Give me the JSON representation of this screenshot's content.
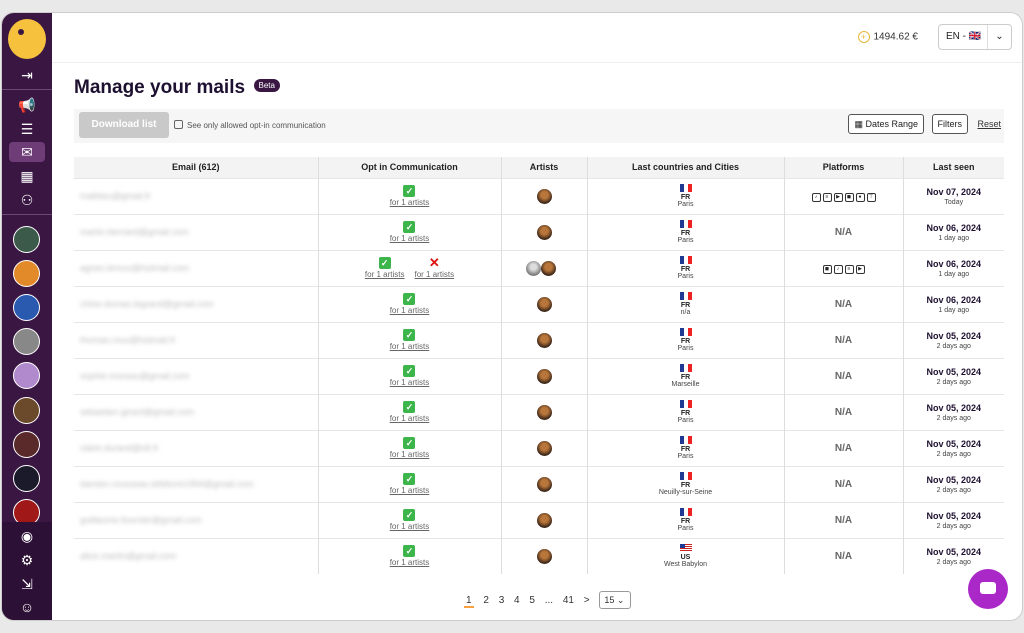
{
  "header": {
    "balance": "1494.62 €",
    "language": "EN - 🇬🇧",
    "coin_symbol": "+"
  },
  "page": {
    "title": "Manage your mails",
    "badge": "Beta"
  },
  "toolbar": {
    "download_label": "Download list",
    "optin_filter_label": "See only allowed opt-in communication",
    "dates_range_label": "Dates Range",
    "filters_label": "Filters",
    "reset_label": "Reset"
  },
  "table": {
    "columns": [
      "Email (612)",
      "Opt in Communication",
      "Artists",
      "Last countries and Cities",
      "Platforms",
      "Last seen"
    ],
    "rows": [
      {
        "email": "mathieu@gmail.fr",
        "opt": [
          "for 1 artists"
        ],
        "optout": "",
        "artists": 1,
        "country": "FR",
        "city": "Paris",
        "platforms": [
          "♪",
          "≡",
          "▶",
          "◼",
          "●",
          "⊤"
        ],
        "platforms_na": "",
        "date": "Nov 07, 2024",
        "ago": "Today"
      },
      {
        "email": "martin.bernard@gmail.com",
        "opt": [
          "for 1 artists"
        ],
        "optout": "",
        "artists": 1,
        "country": "FR",
        "city": "Paris",
        "platforms": [],
        "platforms_na": "N/A",
        "date": "Nov 06, 2024",
        "ago": "1 day ago"
      },
      {
        "email": "agnes.leroux@hotmail.com",
        "opt": [
          "for 1 artists"
        ],
        "optout": "for 1 artists",
        "artists": 2,
        "country": "FR",
        "city": "Paris",
        "platforms": [
          "◼",
          "♪",
          "≡",
          "▶"
        ],
        "platforms_na": "",
        "date": "Nov 06, 2024",
        "ago": "1 day ago"
      },
      {
        "email": "chloe.dumas.legrand@gmail.com",
        "opt": [
          "for 1 artists"
        ],
        "optout": "",
        "artists": 1,
        "country": "FR",
        "city": "n/a",
        "platforms": [],
        "platforms_na": "N/A",
        "date": "Nov 06, 2024",
        "ago": "1 day ago"
      },
      {
        "email": "thomas.roux@hotmail.fr",
        "opt": [
          "for 1 artists"
        ],
        "optout": "",
        "artists": 1,
        "country": "FR",
        "city": "Paris",
        "platforms": [],
        "platforms_na": "N/A",
        "date": "Nov 05, 2024",
        "ago": "2 days ago"
      },
      {
        "email": "sophie.moreau@gmail.com",
        "opt": [
          "for 1 artists"
        ],
        "optout": "",
        "artists": 1,
        "country": "FR",
        "city": "Marseille",
        "platforms": [],
        "platforms_na": "N/A",
        "date": "Nov 05, 2024",
        "ago": "2 days ago"
      },
      {
        "email": "sebastien.girard@gmail.com",
        "opt": [
          "for 1 artists"
        ],
        "optout": "",
        "artists": 1,
        "country": "FR",
        "city": "Paris",
        "platforms": [],
        "platforms_na": "N/A",
        "date": "Nov 05, 2024",
        "ago": "2 days ago"
      },
      {
        "email": "claire.durand@sfr.fr",
        "opt": [
          "for 1 artists"
        ],
        "optout": "",
        "artists": 1,
        "country": "FR",
        "city": "Paris",
        "platforms": [],
        "platforms_na": "N/A",
        "date": "Nov 05, 2024",
        "ago": "2 days ago"
      },
      {
        "email": "damien.rousseau.lefebvre1994@gmail.com",
        "opt": [
          "for 1 artists"
        ],
        "optout": "",
        "artists": 1,
        "country": "FR",
        "city": "Neuilly-sur-Seine",
        "platforms": [],
        "platforms_na": "N/A",
        "date": "Nov 05, 2024",
        "ago": "2 days ago"
      },
      {
        "email": "guillaume.fournier@gmail.com",
        "opt": [
          "for 1 artists"
        ],
        "optout": "",
        "artists": 1,
        "country": "FR",
        "city": "Paris",
        "platforms": [],
        "platforms_na": "N/A",
        "date": "Nov 05, 2024",
        "ago": "2 days ago"
      },
      {
        "email": "alice.martin@gmail.com",
        "opt": [
          "for 1 artists"
        ],
        "optout": "",
        "artists": 1,
        "country": "US",
        "city": "West Babylon",
        "platforms": [],
        "platforms_na": "N/A",
        "date": "Nov 05, 2024",
        "ago": "2 days ago"
      }
    ]
  },
  "pagination": {
    "pages": [
      "1",
      "2",
      "3",
      "4",
      "5",
      "...",
      "41",
      ">"
    ],
    "per_page": "15 ⌄"
  },
  "colors": {
    "sidebar": "#3a1643",
    "accent": "#f6a13e",
    "chat": "#a928c7"
  }
}
